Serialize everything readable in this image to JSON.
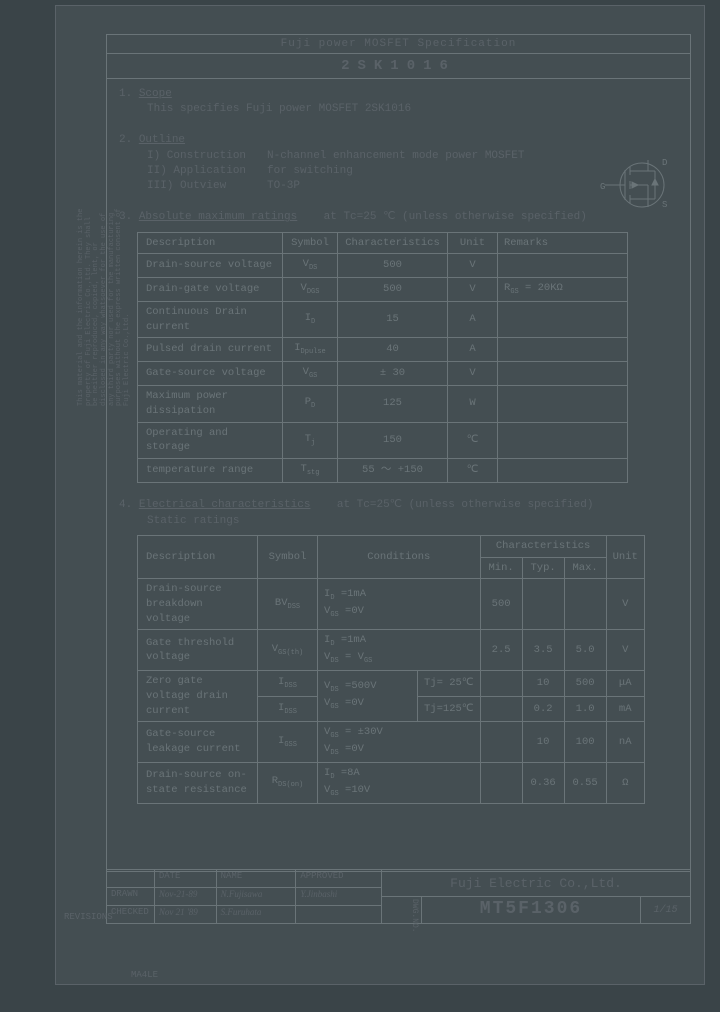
{
  "header": {
    "title": "Fuji power MOSFET Specification",
    "part_number": "2SK1016"
  },
  "sections": {
    "s1": {
      "num": "1.",
      "title": "Scope",
      "text": "This specifies Fuji power MOSFET  2SK1016"
    },
    "s2": {
      "num": "2.",
      "title": "Outline",
      "items": [
        {
          "n": "I) Construction",
          "v": "N-channel enhancement mode power MOSFET"
        },
        {
          "n": "II) Application",
          "v": "for switching"
        },
        {
          "n": "III) Outview",
          "v": "TO-3P"
        }
      ]
    },
    "s3": {
      "num": "3.",
      "title": "Absolute maximum ratings",
      "cond": "at Tc=25 ℃  (unless otherwise specified)",
      "headers": {
        "desc": "Description",
        "sym": "Symbol",
        "char": "Characteristics",
        "unit": "Unit",
        "rem": "Remarks"
      },
      "rows": [
        {
          "desc": "Drain-source voltage",
          "sym": "V_DS",
          "char": "500",
          "unit": "V",
          "rem": ""
        },
        {
          "desc": "Drain-gate voltage",
          "sym": "V_DGS",
          "char": "500",
          "unit": "V",
          "rem": "R_GS = 20KΩ"
        },
        {
          "desc": "Continuous Drain current",
          "sym": "I_D",
          "char": "15",
          "unit": "A",
          "rem": ""
        },
        {
          "desc": "Pulsed drain current",
          "sym": "I_Dpulse",
          "char": "40",
          "unit": "A",
          "rem": ""
        },
        {
          "desc": "Gate-source voltage",
          "sym": "V_GS",
          "char": "± 30",
          "unit": "V",
          "rem": ""
        },
        {
          "desc": "Maximum power dissipation",
          "sym": "P_D",
          "char": "125",
          "unit": "W",
          "rem": ""
        },
        {
          "desc": "Operating and storage",
          "sym": "T_j",
          "char": "150",
          "unit": "℃",
          "rem": ""
        },
        {
          "desc": "temperature range",
          "sym": "T_stg",
          "char": "55 ～ +150",
          "unit": "℃",
          "rem": ""
        }
      ]
    },
    "s4": {
      "num": "4.",
      "title": "Electrical characteristics",
      "cond": "at Tc=25℃  (unless otherwise specified)",
      "sub": "Static ratings",
      "headers": {
        "desc": "Description",
        "sym": "Symbol",
        "cond": "Conditions",
        "char": "Characteristics",
        "min": "Min.",
        "typ": "Typ.",
        "max": "Max.",
        "unit": "Unit"
      },
      "rows": [
        {
          "desc": "Drain-source breakdown voltage",
          "sym": "BV_DSS",
          "cond": "I_D =1mA\nV_GS =0V",
          "cond2": "",
          "min": "500",
          "typ": "",
          "max": "",
          "unit": "V"
        },
        {
          "desc": "Gate threshold voltage",
          "sym": "V_GS(th)",
          "cond": "I_D =1mA\nV_DS = V_GS",
          "cond2": "",
          "min": "2.5",
          "typ": "3.5",
          "max": "5.0",
          "unit": "V"
        },
        {
          "desc": "Zero gate voltage drain current",
          "sym": "I_DSS",
          "cond": "V_DS =500V\nV_GS =0V",
          "cond2": "Tj= 25℃",
          "min": "",
          "typ": "10",
          "max": "500",
          "unit": "μA"
        },
        {
          "desc": "",
          "sym": "I_DSS",
          "cond": "",
          "cond2": "Tj=125℃",
          "min": "",
          "typ": "0.2",
          "max": "1.0",
          "unit": "mA"
        },
        {
          "desc": "Gate-source leakage current",
          "sym": "I_GSS",
          "cond": "V_GS = ±30V\nV_DS =0V",
          "cond2": "",
          "min": "",
          "typ": "10",
          "max": "100",
          "unit": "nA"
        },
        {
          "desc": "Drain-source on-state resistance",
          "sym": "R_DS(on)",
          "cond": "I_D =8A\nV_GS =10V",
          "cond2": "",
          "min": "",
          "typ": "0.36",
          "max": "0.55",
          "unit": "Ω"
        }
      ]
    }
  },
  "symbol": {
    "g": "G",
    "d": "D",
    "s": "S"
  },
  "titleblock": {
    "h_date": "DATE",
    "h_name": "NAME",
    "h_appr": "APPROVED",
    "drawn": "DRAWN",
    "drawn_date": "Nov-21-89",
    "drawn_name": "N.Fujisawa",
    "checked": "CHECKED",
    "checked_date": "Nov 21 '89",
    "checked_name": "S.Furuhata",
    "approved_sig": "Y.Jinbashi",
    "company": "Fuji Electric Co.,Ltd.",
    "dwg_label": "DWG.NO.",
    "dwg_no": "MT5F1306",
    "page": "1/15"
  },
  "footer": {
    "revisions": "REVISIONS",
    "form": "MA4LE",
    "side_notice": "This material and the information herein is the property of Fuji Electric Co.,Ltd. They shall be neither reproduced, copied, lent, or disclosed in any way whatsoever for the use of any third party nor used for the manufacturing purposes without the express written consent of Fuji Electric Co.,Ltd."
  }
}
